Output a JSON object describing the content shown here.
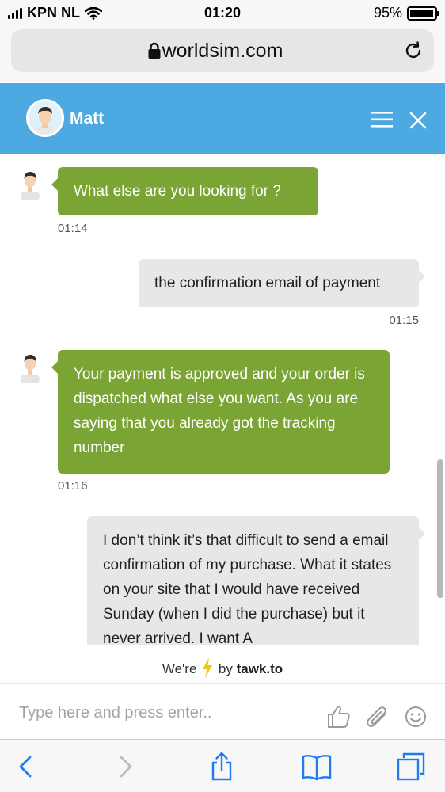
{
  "status_bar": {
    "carrier": "KPN NL",
    "time": "01:20",
    "battery": "95%",
    "battery_level": 0.95
  },
  "browser": {
    "url": "worldsim.com",
    "icons": [
      "lock-icon",
      "reload-icon"
    ]
  },
  "chat_header": {
    "agent_name": "Matt",
    "accent_color": "#4da9e1",
    "icons": [
      "agent-avatar",
      "menu-icon",
      "close-icon"
    ]
  },
  "messages": [
    {
      "sender": "agent",
      "text": "What else are you looking for ?",
      "time": "01:14"
    },
    {
      "sender": "visitor",
      "text": "the confirmation email of payment",
      "time": "01:15"
    },
    {
      "sender": "agent",
      "text": "Your payment is approved and your order is dispatched what else you want. As you are saying that you already got the tracking number",
      "time": "01:16"
    },
    {
      "sender": "visitor",
      "text": "I don’t think it’s that difficult to send a email confirmation of my purchase. What it states on your site that I would have received Sunday (when I did the purchase) but it never arrived. I want A",
      "time": ""
    }
  ],
  "colors": {
    "agent_bubble": "#7aa535",
    "visitor_bubble": "#e7e7e8"
  },
  "branding": {
    "prefix": "We're",
    "middle": "by",
    "brand": "tawk.to",
    "icon": "lightning-bolt-icon"
  },
  "composer": {
    "placeholder": "Type here and press enter..",
    "value": "",
    "icons": [
      "thumbs-up-icon",
      "paperclip-icon",
      "smiley-icon"
    ]
  },
  "toolbar": {
    "icons": [
      "back-icon",
      "forward-icon",
      "share-icon",
      "bookmarks-icon",
      "tabs-icon"
    ]
  }
}
